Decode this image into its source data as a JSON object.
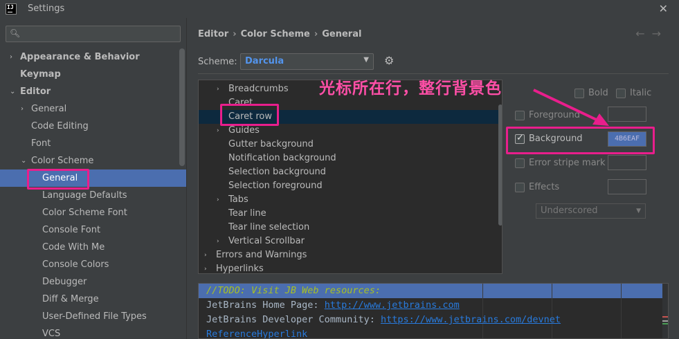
{
  "window": {
    "title": "Settings",
    "app_icon_text": "IJ"
  },
  "sidebar": {
    "search_placeholder": "",
    "items": [
      {
        "label": "Appearance & Behavior",
        "level": 0,
        "arrow": "›",
        "bold": true
      },
      {
        "label": "Keymap",
        "level": 0,
        "arrow": "",
        "bold": true
      },
      {
        "label": "Editor",
        "level": 0,
        "arrow": "⌄",
        "bold": true
      },
      {
        "label": "General",
        "level": 1,
        "arrow": "›"
      },
      {
        "label": "Code Editing",
        "level": 1,
        "arrow": ""
      },
      {
        "label": "Font",
        "level": 1,
        "arrow": ""
      },
      {
        "label": "Color Scheme",
        "level": 1,
        "arrow": "⌄"
      },
      {
        "label": "General",
        "level": 2,
        "arrow": "",
        "selected": true
      },
      {
        "label": "Language Defaults",
        "level": 2,
        "arrow": ""
      },
      {
        "label": "Color Scheme Font",
        "level": 2,
        "arrow": ""
      },
      {
        "label": "Console Font",
        "level": 2,
        "arrow": ""
      },
      {
        "label": "Code With Me",
        "level": 2,
        "arrow": ""
      },
      {
        "label": "Console Colors",
        "level": 2,
        "arrow": ""
      },
      {
        "label": "Debugger",
        "level": 2,
        "arrow": ""
      },
      {
        "label": "Diff & Merge",
        "level": 2,
        "arrow": ""
      },
      {
        "label": "User-Defined File Types",
        "level": 2,
        "arrow": ""
      },
      {
        "label": "VCS",
        "level": 2,
        "arrow": ""
      }
    ]
  },
  "breadcrumb": {
    "part1": "Editor",
    "part2": "Color Scheme",
    "part3": "General",
    "sep": "›"
  },
  "scheme": {
    "label": "Scheme:",
    "value": "Darcula"
  },
  "attributes": [
    {
      "label": "Breadcrumbs",
      "level": 1,
      "arrow": "›"
    },
    {
      "label": "Caret",
      "level": 1,
      "arrow": ""
    },
    {
      "label": "Caret row",
      "level": 1,
      "arrow": "",
      "selected": true
    },
    {
      "label": "Guides",
      "level": 1,
      "arrow": "›"
    },
    {
      "label": "Gutter background",
      "level": 1,
      "arrow": ""
    },
    {
      "label": "Notification background",
      "level": 1,
      "arrow": ""
    },
    {
      "label": "Selection background",
      "level": 1,
      "arrow": ""
    },
    {
      "label": "Selection foreground",
      "level": 1,
      "arrow": ""
    },
    {
      "label": "Tabs",
      "level": 1,
      "arrow": "›"
    },
    {
      "label": "Tear line",
      "level": 1,
      "arrow": ""
    },
    {
      "label": "Tear line selection",
      "level": 1,
      "arrow": ""
    },
    {
      "label": "Vertical Scrollbar",
      "level": 1,
      "arrow": "›"
    },
    {
      "label": "Errors and Warnings",
      "level": 0,
      "arrow": "›"
    },
    {
      "label": "Hyperlinks",
      "level": 0,
      "arrow": "›"
    }
  ],
  "options": {
    "bold": "Bold",
    "italic": "Italic",
    "foreground": "Foreground",
    "background": "Background",
    "background_checked": true,
    "background_color": "4B6EAF",
    "error_stripe": "Error stripe mark",
    "effects": "Effects",
    "effect_type": "Underscored"
  },
  "preview": {
    "line1": "//TODO: Visit JB Web resources:",
    "line2_label": "JetBrains Home Page: ",
    "line2_link": "http://www.jetbrains.com",
    "line3_label": "JetBrains Developer Community: ",
    "line3_link": "https://www.jetbrains.com/devnet",
    "line4_link": "ReferenceHyperlink"
  },
  "annotation": {
    "text": "光标所在行，整行背景色",
    "color": "#e91e8c"
  },
  "colors": {
    "accent": "#4b6eaf",
    "link": "#287bde",
    "todo": "#a8c023",
    "annotation": "#e91e8c"
  }
}
